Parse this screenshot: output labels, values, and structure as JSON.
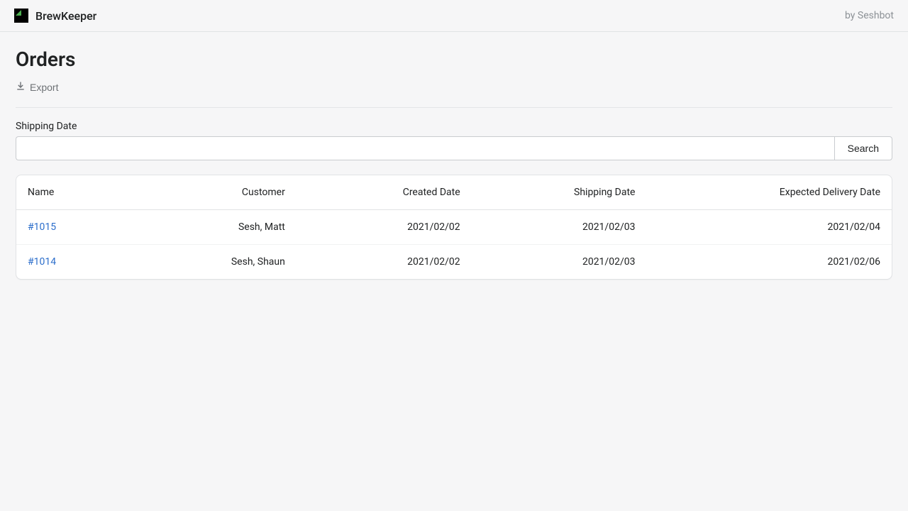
{
  "header": {
    "brand": "BrewKeeper",
    "byline": "by Seshbot"
  },
  "page": {
    "title": "Orders",
    "export_label": "Export"
  },
  "filter": {
    "label": "Shipping Date",
    "value": "",
    "search_label": "Search"
  },
  "table": {
    "columns": {
      "name": "Name",
      "customer": "Customer",
      "created": "Created Date",
      "shipping": "Shipping Date",
      "expected": "Expected Delivery Date"
    },
    "rows": [
      {
        "name": "#1015",
        "customer": "Sesh, Matt",
        "created": "2021/02/02",
        "shipping": "2021/02/03",
        "expected": "2021/02/04"
      },
      {
        "name": "#1014",
        "customer": "Sesh, Shaun",
        "created": "2021/02/02",
        "shipping": "2021/02/03",
        "expected": "2021/02/06"
      }
    ]
  }
}
